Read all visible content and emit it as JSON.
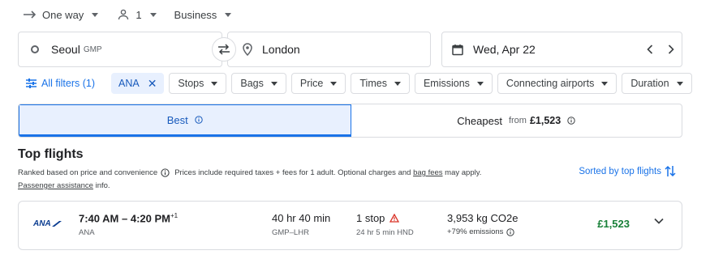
{
  "trip": {
    "type_label": "One way",
    "passengers": "1",
    "cabin_class": "Business"
  },
  "search": {
    "origin_city": "Seoul",
    "origin_code": "GMP",
    "destination": "London",
    "date": "Wed, Apr 22"
  },
  "filters": {
    "all_filters_label": "All filters (1)",
    "active_chip": "ANA",
    "chips": [
      "Stops",
      "Bags",
      "Price",
      "Times",
      "Emissions",
      "Connecting airports",
      "Duration"
    ]
  },
  "sort_tabs": {
    "best_label": "Best",
    "cheapest_label": "Cheapest",
    "cheapest_from": "from",
    "cheapest_price": "£1,523"
  },
  "results": {
    "title": "Top flights",
    "ranked_text": "Ranked based on price and convenience",
    "prices_text": "Prices include required taxes + fees for 1 adult. Optional charges and",
    "bag_fees_link": "bag fees",
    "may_apply": "may apply.",
    "passenger_assistance": "Passenger assistance",
    "info_suffix": "info.",
    "sorted_by": "Sorted by top flights"
  },
  "flights": [
    {
      "airline_logo_text": "ANA",
      "depart": "7:40 AM",
      "dash": "–",
      "arrive": "4:20 PM",
      "day_offset": "+1",
      "airline": "ANA",
      "duration": "40 hr 40 min",
      "route": "GMP–LHR",
      "stops": "1 stop",
      "layover": "24 hr 5 min HND",
      "emissions": "3,953 kg CO2e",
      "emissions_diff": "+79% emissions",
      "price": "£1,523"
    }
  ],
  "colors": {
    "accent": "#1a73e8",
    "active_tab_bg": "#e8f0fe",
    "price_green": "#188038",
    "warning_red": "#d93025"
  },
  "icons": {
    "trip": "arrow-right-icon",
    "passengers": "person-icon",
    "origin": "circle-icon",
    "destination": "location-pin-icon",
    "date": "calendar-icon",
    "swap": "swap-arrows-icon",
    "filters": "sliders-icon",
    "info": "info-icon",
    "warning": "warning-triangle-icon",
    "sort": "sort-arrows-icon",
    "expand": "chevron-down-icon"
  }
}
